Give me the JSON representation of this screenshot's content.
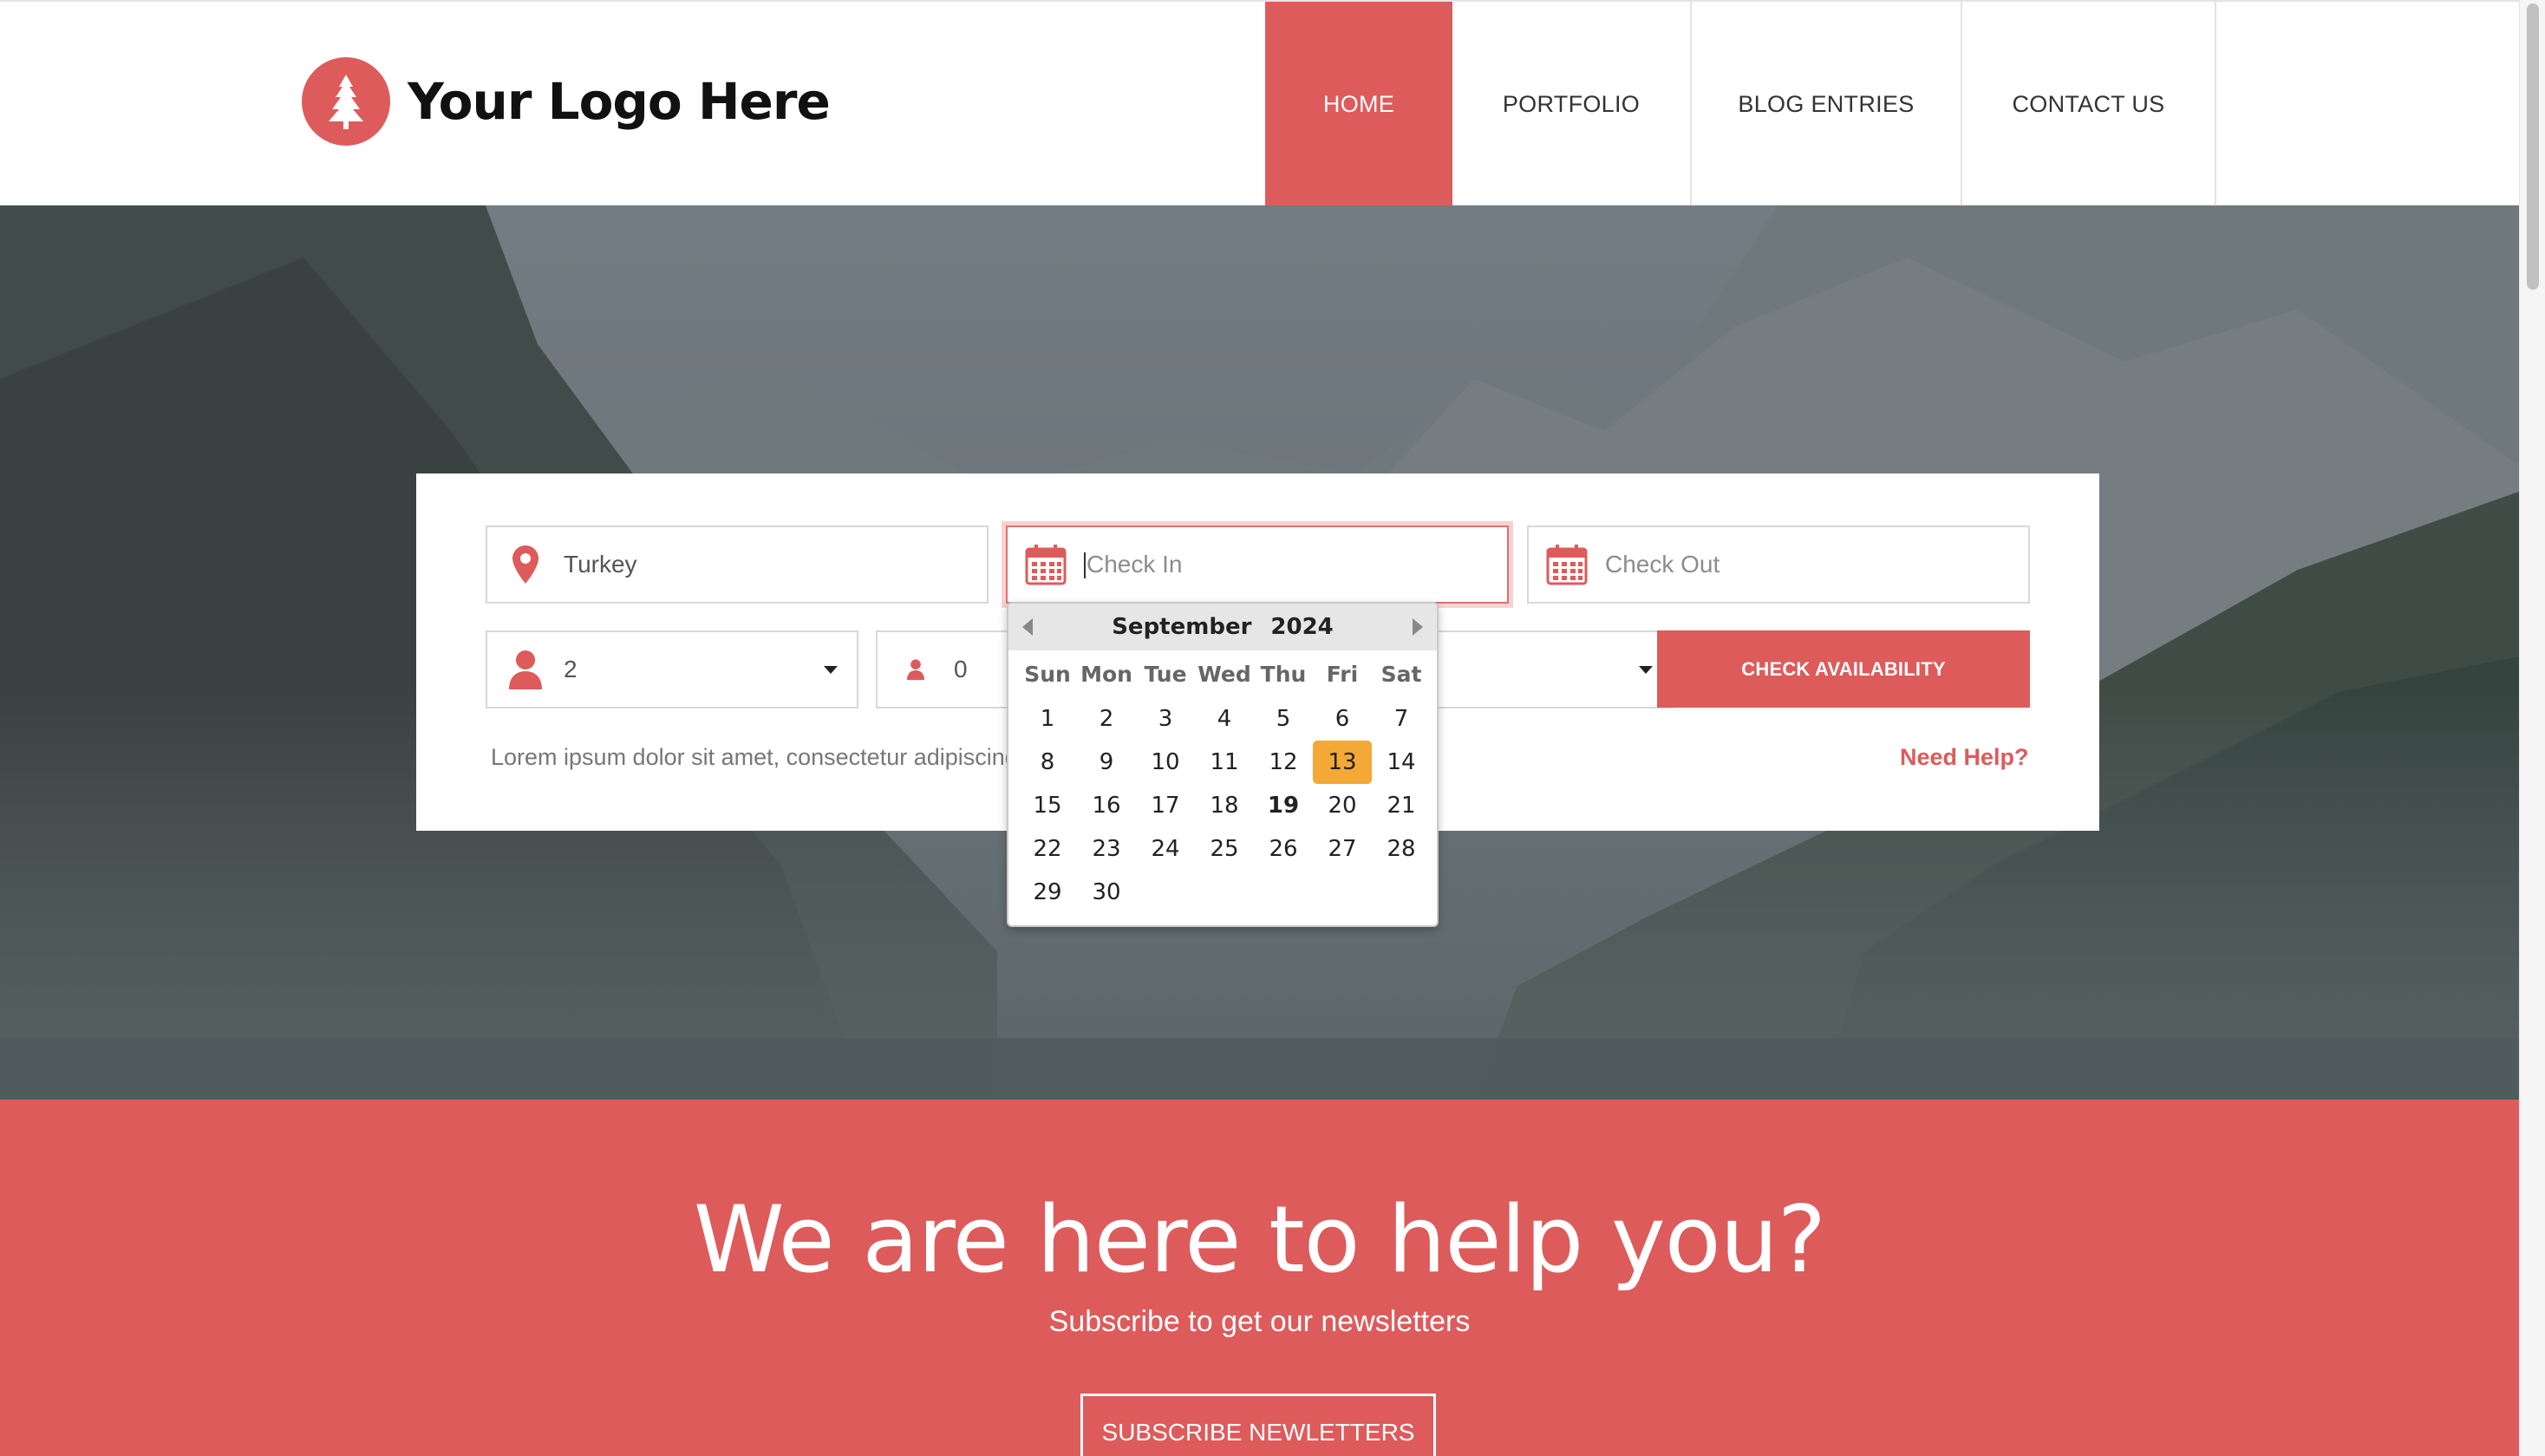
{
  "logo": {
    "text": "Your Logo Here",
    "icon": "pine-tree-icon"
  },
  "nav": {
    "items": [
      {
        "label": "HOME",
        "active": true
      },
      {
        "label": "PORTFOLIO",
        "active": false
      },
      {
        "label": "BLOG ENTRIES",
        "active": false
      },
      {
        "label": "CONTACT US",
        "active": false
      }
    ]
  },
  "booking": {
    "location": {
      "value": "Turkey",
      "icon": "location-pin-icon"
    },
    "check_in": {
      "placeholder": "Check In",
      "icon": "calendar-icon"
    },
    "check_out": {
      "placeholder": "Check Out",
      "icon": "calendar-icon"
    },
    "adults": {
      "value": "2",
      "icon": "user-icon"
    },
    "children": {
      "value": "0",
      "icon": "user-small-icon"
    },
    "check_button": "CHECK AVAILABILITY",
    "note": "Lorem ipsum dolor sit amet, consectetur adipiscing elit",
    "help_link": "Need Help?"
  },
  "datepicker": {
    "month": "September",
    "year": "2024",
    "weekdays": [
      "Sun",
      "Mon",
      "Tue",
      "Wed",
      "Thu",
      "Fri",
      "Sat"
    ],
    "days": [
      "1",
      "2",
      "3",
      "4",
      "5",
      "6",
      "7",
      "8",
      "9",
      "10",
      "11",
      "12",
      "13",
      "14",
      "15",
      "16",
      "17",
      "18",
      "19",
      "20",
      "21",
      "22",
      "23",
      "24",
      "25",
      "26",
      "27",
      "28",
      "29",
      "30"
    ],
    "first_weekday_index": 0,
    "selected_day": "13",
    "today": "19"
  },
  "cta": {
    "title": "We are here to help you?",
    "subtitle": "Subscribe to get our newsletters",
    "button": "SUBSCRIBE NEWLETTERS"
  },
  "colors": {
    "accent": "#dd5b5b",
    "selected_day": "#f4a836"
  }
}
